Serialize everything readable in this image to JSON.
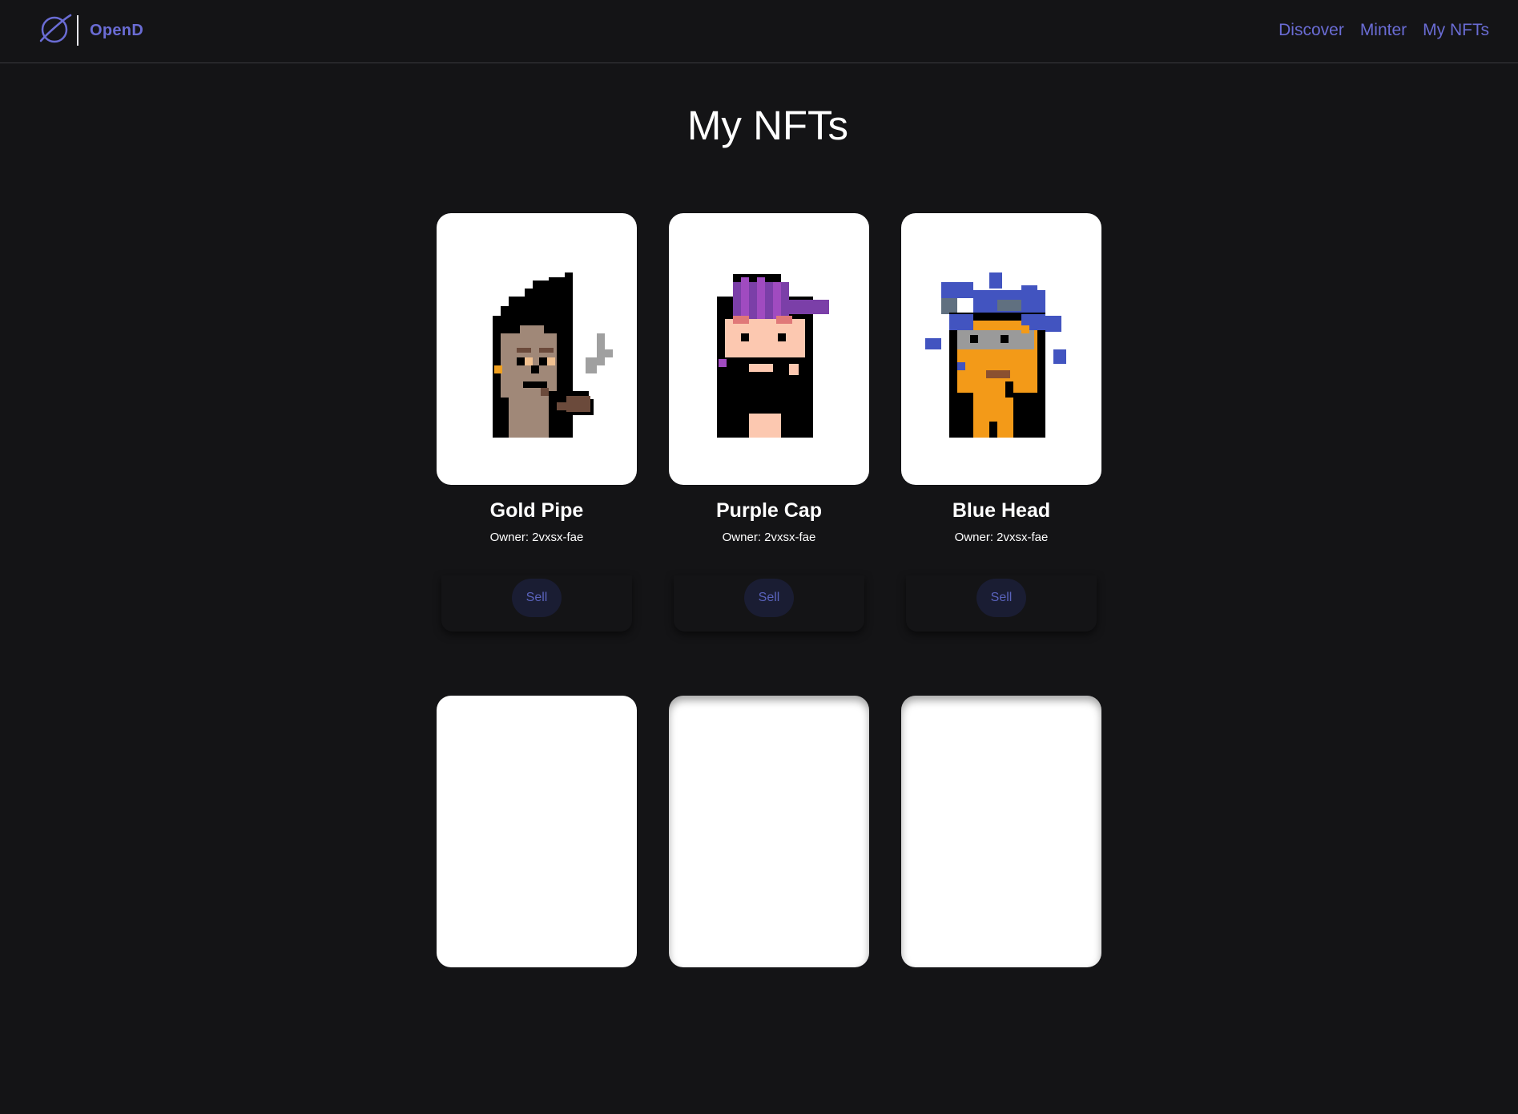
{
  "header": {
    "brand_name": "OpenD",
    "nav": [
      {
        "label": "Discover"
      },
      {
        "label": "Minter"
      },
      {
        "label": "My NFTs"
      }
    ]
  },
  "main": {
    "title": "My NFTs",
    "nfts": [
      {
        "name": "Gold Pipe",
        "owner": "Owner: 2vxsx-fae",
        "button": "Sell"
      },
      {
        "name": "Purple Cap",
        "owner": "Owner: 2vxsx-fae",
        "button": "Sell"
      },
      {
        "name": "Blue Head",
        "owner": "Owner: 2vxsx-fae",
        "button": "Sell"
      }
    ]
  },
  "icons": {
    "logo": "planet-logo-icon"
  },
  "colors": {
    "background": "#141416",
    "accent": "#6a6cd4",
    "button_bg": "#1a1d33",
    "button_text": "#5a63bc"
  }
}
